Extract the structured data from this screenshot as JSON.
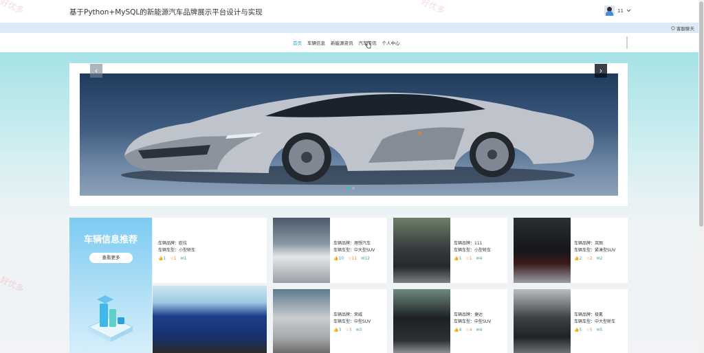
{
  "header": {
    "title": "基于Python+MySQL的新能源汽车品牌展示平台设计与实现",
    "user_name": "11",
    "service_label": "客服聊天"
  },
  "nav": {
    "items": [
      {
        "label": "首页",
        "active": true
      },
      {
        "label": "车辆信息",
        "active": false
      },
      {
        "label": "新能源资讯",
        "active": false
      },
      {
        "label": "汽车资讯",
        "active": false
      },
      {
        "label": "个人中心",
        "active": false
      }
    ]
  },
  "banner": {
    "prev_label": "‹",
    "next_label": "›",
    "slide_count": 2,
    "active_slide": 0
  },
  "recommend": {
    "title": "车辆信息推荐",
    "more_label": "查看更多",
    "cards": [
      {
        "brand": "车辆品牌：欧拉",
        "type": "车辆车型：小型轿车",
        "likes": "1",
        "favs": "1",
        "comments": "1"
      },
      {
        "brand": "车辆品牌：理想汽车",
        "type": "车辆车型：中大型SUV",
        "likes": "10",
        "favs": "11",
        "comments": "12"
      },
      {
        "brand": "车辆品牌：111",
        "type": "车辆车型：小型轿车",
        "likes": "1",
        "favs": "1",
        "comments": "4"
      },
      {
        "brand": "车辆品牌：岚图",
        "type": "车辆车型：紧凑型SUV",
        "likes": "2",
        "favs": "2",
        "comments": "2"
      },
      {
        "brand": "车辆品牌：荣威",
        "type": "车辆车型：中型SUV",
        "likes": "3",
        "favs": "3",
        "comments": "3"
      },
      {
        "brand": "车辆品牌：捷达",
        "type": "车辆车型：中型SUV",
        "likes": "4",
        "favs": "4",
        "comments": "4"
      },
      {
        "brand": "车辆品牌：极氪",
        "type": "车辆车型：中大型轿车",
        "likes": "5",
        "favs": "5",
        "comments": "5"
      }
    ]
  },
  "watermark": "好优多",
  "colors": {
    "accent": "#22a6c8",
    "like": "#27a1d8",
    "fav": "#e8823a",
    "comment": "#4aa56b"
  }
}
